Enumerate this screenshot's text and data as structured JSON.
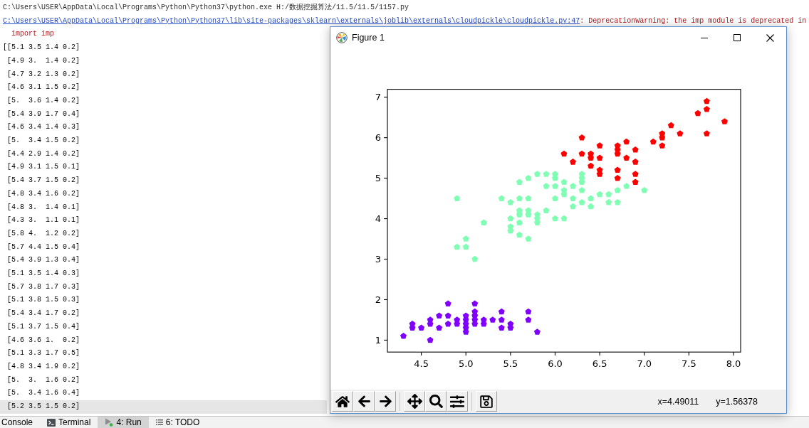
{
  "console": {
    "command": "C:\\Users\\USER\\AppData\\Local\\Programs\\Python\\Python37\\python.exe H:/数据挖掘算法/11.5/11.5/1157.py",
    "warning": {
      "source_link": "C:\\Users\\USER\\AppData\\Local\\Programs\\Python\\Python37\\lib\\site-packages\\sklearn\\externals\\joblib\\externals\\cloudpickle\\cloudpickle.py:47",
      "message": ": DeprecationWarning: the imp module is deprecated in",
      "code_line": "import imp"
    },
    "rows": [
      {
        "text": "[[5.1 3.5 1.4 0.2]",
        "highlighted": false
      },
      {
        "text": " [4.9 3.  1.4 0.2]",
        "highlighted": false
      },
      {
        "text": " [4.7 3.2 1.3 0.2]",
        "highlighted": false
      },
      {
        "text": " [4.6 3.1 1.5 0.2]",
        "highlighted": false
      },
      {
        "text": " [5.  3.6 1.4 0.2]",
        "highlighted": false
      },
      {
        "text": " [5.4 3.9 1.7 0.4]",
        "highlighted": false
      },
      {
        "text": " [4.6 3.4 1.4 0.3]",
        "highlighted": false
      },
      {
        "text": " [5.  3.4 1.5 0.2]",
        "highlighted": false
      },
      {
        "text": " [4.4 2.9 1.4 0.2]",
        "highlighted": false
      },
      {
        "text": " [4.9 3.1 1.5 0.1]",
        "highlighted": false
      },
      {
        "text": " [5.4 3.7 1.5 0.2]",
        "highlighted": false
      },
      {
        "text": " [4.8 3.4 1.6 0.2]",
        "highlighted": false
      },
      {
        "text": " [4.8 3.  1.4 0.1]",
        "highlighted": false
      },
      {
        "text": " [4.3 3.  1.1 0.1]",
        "highlighted": false
      },
      {
        "text": " [5.8 4.  1.2 0.2]",
        "highlighted": false
      },
      {
        "text": " [5.7 4.4 1.5 0.4]",
        "highlighted": false
      },
      {
        "text": " [5.4 3.9 1.3 0.4]",
        "highlighted": false
      },
      {
        "text": " [5.1 3.5 1.4 0.3]",
        "highlighted": false
      },
      {
        "text": " [5.7 3.8 1.7 0.3]",
        "highlighted": false
      },
      {
        "text": " [5.1 3.8 1.5 0.3]",
        "highlighted": false
      },
      {
        "text": " [5.4 3.4 1.7 0.2]",
        "highlighted": false
      },
      {
        "text": " [5.1 3.7 1.5 0.4]",
        "highlighted": false
      },
      {
        "text": " [4.6 3.6 1.  0.2]",
        "highlighted": false
      },
      {
        "text": " [5.1 3.3 1.7 0.5]",
        "highlighted": false
      },
      {
        "text": " [4.8 3.4 1.9 0.2]",
        "highlighted": false
      },
      {
        "text": " [5.  3.  1.6 0.2]",
        "highlighted": false
      },
      {
        "text": " [5.  3.4 1.6 0.4]",
        "highlighted": false
      },
      {
        "text": " [5.2 3.5 1.5 0.2]",
        "highlighted": true
      }
    ]
  },
  "figure_window": {
    "title": "Figure 1",
    "chart_data": [
      {
        "type": "scatter",
        "xlim": [
          4.12,
          8.08
        ],
        "ylim": [
          0.705,
          7.195
        ],
        "xticks": [
          {
            "value": 4.5,
            "label": "4.5"
          },
          {
            "value": 5,
            "label": "5.0"
          },
          {
            "value": 5.5,
            "label": "5.5"
          },
          {
            "value": 6,
            "label": "6.0"
          },
          {
            "value": 6.5,
            "label": "6.5"
          },
          {
            "value": 7,
            "label": "7.0"
          },
          {
            "value": 7.5,
            "label": "7.5"
          },
          {
            "value": 8,
            "label": "8.0"
          }
        ],
        "yticks": [
          1,
          2,
          3,
          4,
          5,
          6,
          7
        ],
        "series": [
          {
            "color": "#8000ff",
            "x": [
              4.3,
              4.4,
              4.4,
              4.5,
              4.6,
              4.6,
              4.6,
              4.7,
              4.7,
              4.8,
              4.8,
              4.8,
              4.9,
              4.9,
              5.0,
              5.0,
              5.0,
              5.0,
              5.0,
              5.1,
              5.1,
              5.1,
              5.1,
              5.1,
              5.2,
              5.2,
              5.3,
              5.4,
              5.4,
              5.4,
              5.5,
              5.5,
              5.7,
              5.7,
              5.8
            ],
            "values": [
              1.1,
              1.3,
              1.4,
              1.3,
              1.0,
              1.4,
              1.5,
              1.3,
              1.6,
              1.4,
              1.6,
              1.9,
              1.4,
              1.5,
              1.2,
              1.3,
              1.4,
              1.5,
              1.6,
              1.4,
              1.5,
              1.6,
              1.7,
              1.9,
              1.4,
              1.5,
              1.5,
              1.3,
              1.5,
              1.7,
              1.3,
              1.4,
              1.5,
              1.7,
              1.2
            ]
          },
          {
            "color": "#80ffb4",
            "x": [
              4.9,
              4.9,
              5.0,
              5.0,
              5.1,
              5.2,
              5.4,
              5.5,
              5.5,
              5.5,
              5.5,
              5.6,
              5.6,
              5.6,
              5.6,
              5.6,
              5.6,
              5.7,
              5.7,
              5.7,
              5.7,
              5.7,
              5.8,
              5.8,
              5.8,
              5.8,
              5.9,
              5.9,
              5.9,
              6.0,
              6.0,
              6.0,
              6.0,
              6.0,
              6.1,
              6.1,
              6.1,
              6.1,
              6.2,
              6.2,
              6.2,
              6.3,
              6.3,
              6.3,
              6.3,
              6.3,
              6.4,
              6.4,
              6.5,
              6.6,
              6.6,
              6.7,
              6.7,
              6.8,
              7.0
            ],
            "values": [
              3.3,
              4.5,
              3.3,
              3.5,
              3.0,
              3.9,
              4.5,
              3.7,
              3.8,
              4.0,
              4.4,
              3.6,
              3.9,
              4.1,
              4.2,
              4.5,
              4.9,
              3.5,
              4.1,
              4.2,
              4.5,
              5.0,
              3.9,
              4.0,
              4.1,
              5.1,
              4.2,
              4.8,
              5.1,
              4.0,
              4.5,
              4.8,
              5.0,
              5.1,
              4.0,
              4.6,
              4.7,
              4.9,
              4.3,
              4.5,
              4.8,
              4.4,
              4.7,
              4.9,
              5.0,
              5.1,
              4.3,
              4.5,
              4.6,
              4.4,
              4.6,
              4.4,
              4.7,
              4.8,
              4.7
            ]
          },
          {
            "color": "#ff0000",
            "x": [
              6.1,
              6.2,
              6.3,
              6.3,
              6.4,
              6.4,
              6.4,
              6.5,
              6.5,
              6.5,
              6.5,
              6.7,
              6.7,
              6.7,
              6.7,
              6.7,
              6.8,
              6.8,
              6.9,
              6.9,
              6.9,
              6.9,
              7.1,
              7.2,
              7.2,
              7.2,
              7.3,
              7.4,
              7.6,
              7.7,
              7.7,
              7.7,
              7.9
            ],
            "values": [
              5.6,
              5.4,
              5.6,
              6.0,
              5.3,
              5.5,
              5.6,
              5.1,
              5.2,
              5.5,
              5.8,
              5.0,
              5.2,
              5.6,
              5.7,
              5.8,
              5.5,
              5.9,
              4.9,
              5.1,
              5.4,
              5.7,
              5.9,
              5.8,
              6.0,
              6.1,
              6.3,
              6.1,
              6.6,
              6.1,
              6.7,
              6.9,
              6.4
            ]
          }
        ]
      }
    ],
    "coordinates": [
      "x=4.49011",
      "y=1.56378"
    ]
  },
  "tool_tabs": [
    {
      "label": "Console",
      "selected": false
    },
    {
      "label": "Terminal",
      "selected": false
    },
    {
      "label": "4: Run",
      "selected": true
    },
    {
      "label": "6: TODO",
      "selected": false
    }
  ]
}
